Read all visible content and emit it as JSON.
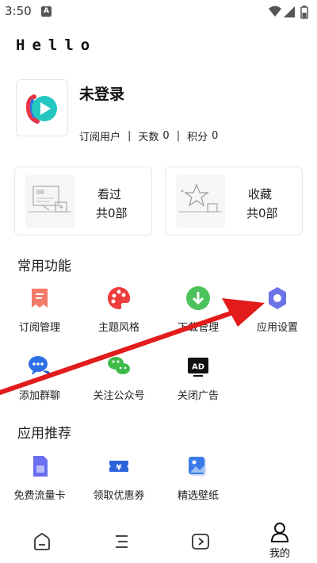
{
  "status_bar": {
    "time": "3:50",
    "notification_icon": "A",
    "icons": [
      "wifi-icon",
      "signal-icon",
      "battery-icon"
    ]
  },
  "header": {
    "greeting": "Hello"
  },
  "profile": {
    "name": "未登录",
    "subscription_label": "订阅用户",
    "days_label": "天数",
    "days_value": "0",
    "points_label": "积分",
    "points_value": "0"
  },
  "cards": {
    "history": {
      "title": "看过",
      "count": "共0部"
    },
    "favorites": {
      "title": "收藏",
      "count": "共0部"
    }
  },
  "common_functions": {
    "title": "常用功能",
    "items": [
      {
        "label": "订阅管理",
        "icon": "subscription-icon"
      },
      {
        "label": "主题风格",
        "icon": "palette-icon"
      },
      {
        "label": "下载管理",
        "icon": "download-icon"
      },
      {
        "label": "应用设置",
        "icon": "gear-icon"
      },
      {
        "label": "添加群聊",
        "icon": "chat-group-icon"
      },
      {
        "label": "关注公众号",
        "icon": "wechat-icon"
      },
      {
        "label": "关闭广告",
        "icon": "ad-icon"
      }
    ]
  },
  "recommend": {
    "title": "应用推荐",
    "items": [
      {
        "label": "免费流量卡",
        "icon": "sim-card-icon"
      },
      {
        "label": "领取优惠券",
        "icon": "coupon-icon"
      },
      {
        "label": "精选壁纸",
        "icon": "wallpaper-icon"
      }
    ]
  },
  "bottom_nav": {
    "items": [
      "home-icon",
      "list-icon",
      "play-icon",
      "profile-icon"
    ],
    "active_label": "我的"
  },
  "colors": {
    "accent_red": "#f03e3e",
    "download_green": "#4cc35a",
    "settings_purple": "#6b73e8",
    "chat_blue": "#2f6fe6",
    "wechat_green": "#3fbb4a"
  }
}
